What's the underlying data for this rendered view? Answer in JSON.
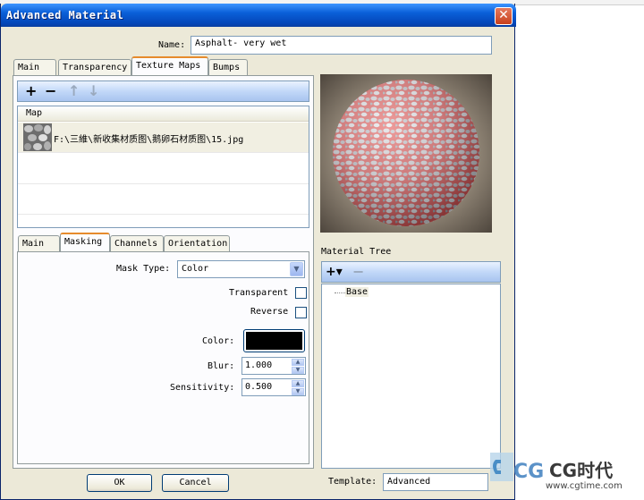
{
  "window": {
    "title": "Advanced Material",
    "close_glyph": "✕"
  },
  "name_field": {
    "label": "Name:",
    "value": "Asphalt- very wet"
  },
  "top_tabs": [
    {
      "label": "Main",
      "active": false
    },
    {
      "label": "Transparency",
      "active": false
    },
    {
      "label": "Texture Maps",
      "active": true
    },
    {
      "label": "Bumps",
      "active": false
    }
  ],
  "map_toolbar": {
    "add": "+",
    "remove": "−",
    "up": "↑",
    "down": "↓"
  },
  "map_list": {
    "column_header": "Map",
    "rows": [
      {
        "path": "F:\\三維\\新收集材质图\\鹅卵石材质图\\15.jpg",
        "thumbnail_icon": "pebble-texture-thumbnail"
      }
    ]
  },
  "sub_tabs": [
    {
      "label": "Main",
      "active": false
    },
    {
      "label": "Masking",
      "active": true
    },
    {
      "label": "Channels",
      "active": false
    },
    {
      "label": "Orientation",
      "active": false
    }
  ],
  "masking": {
    "mask_type_label": "Mask Type:",
    "mask_type_value": "Color",
    "transparent_label": "Transparent",
    "transparent_checked": false,
    "reverse_label": "Reverse",
    "reverse_checked": false,
    "color_label": "Color:",
    "color_value": "#000000",
    "blur_label": "Blur:",
    "blur_value": "1.000",
    "sensitivity_label": "Sensitivity:",
    "sensitivity_value": "0.500"
  },
  "material_tree": {
    "label": "Material Tree",
    "add": "+▾",
    "remove": "−",
    "items": [
      "Base"
    ]
  },
  "template": {
    "label": "Template:",
    "value": "Advanced"
  },
  "buttons": {
    "ok": "OK",
    "cancel": "Cancel"
  },
  "watermark": {
    "brand": "CG时代",
    "url": "www.cgtime.com"
  },
  "colors": {
    "titlebar": "#0a5fd8",
    "dialog_bg": "#ece9d8",
    "mask_highlight": "#e8322f"
  }
}
